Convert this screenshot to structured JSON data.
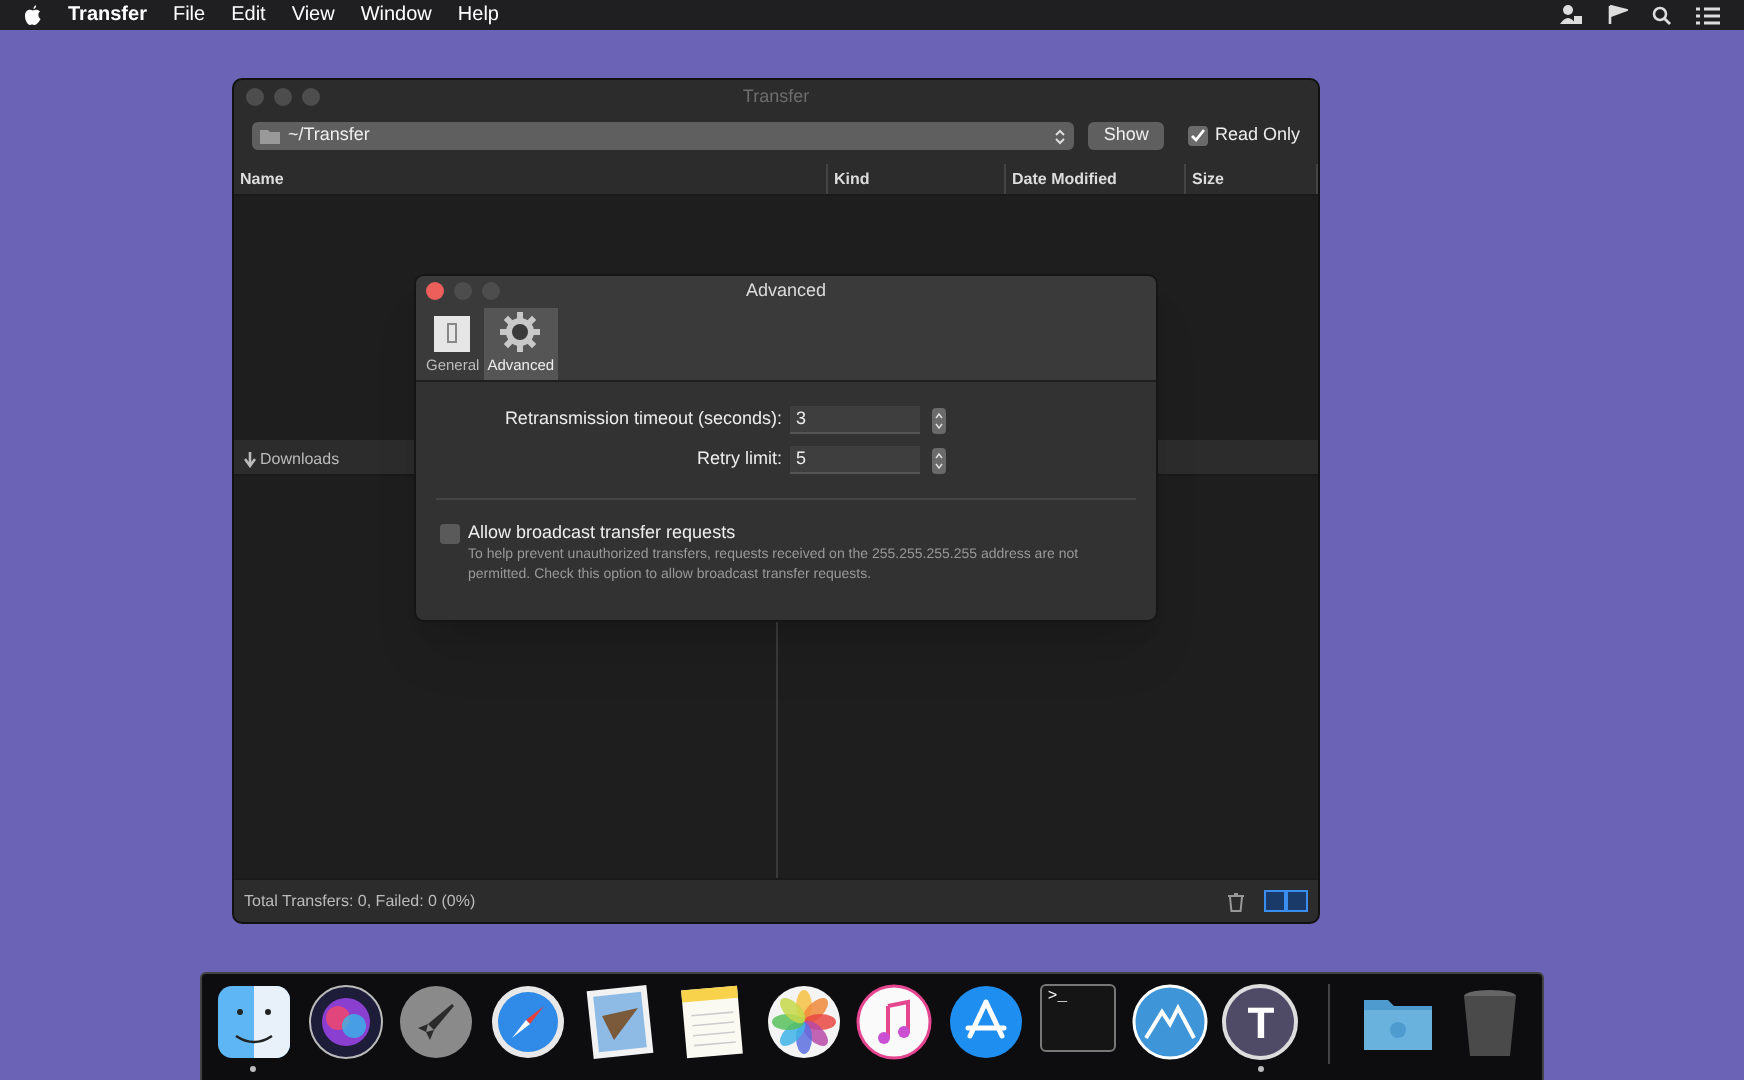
{
  "menu_bar": {
    "app": "Transfer",
    "items": [
      "File",
      "Edit",
      "View",
      "Window",
      "Help"
    ]
  },
  "transfer_window": {
    "title": "Transfer",
    "path": "~/Transfer",
    "show_button": "Show",
    "read_only": {
      "label": "Read Only",
      "checked": true
    },
    "columns": [
      "Name",
      "Kind",
      "Date Modified",
      "Size"
    ],
    "downloads_label": "Downloads",
    "status": "Total Transfers: 0, Failed: 0 (0%)"
  },
  "advanced_dialog": {
    "title": "Advanced",
    "tabs": [
      {
        "label": "General",
        "selected": false,
        "kind": "switch"
      },
      {
        "label": "Advanced",
        "selected": true,
        "kind": "gear"
      }
    ],
    "fields": [
      {
        "label": "Retransmission timeout (seconds):",
        "value": "3"
      },
      {
        "label": "Retry limit:",
        "value": "5"
      }
    ],
    "broadcast": {
      "label": "Allow broadcast transfer requests",
      "checked": false,
      "description": "To help prevent unauthorized transfers, requests received on the 255.255.255.255 address are not permitted. Check this option to allow broadcast transfer requests."
    }
  },
  "dock": {
    "items": [
      {
        "kind": "face",
        "running": true
      },
      {
        "kind": "orb",
        "running": false
      },
      {
        "kind": "rocket",
        "running": false
      },
      {
        "kind": "compass",
        "running": false
      },
      {
        "kind": "stamp",
        "running": false
      },
      {
        "kind": "notes",
        "running": false
      },
      {
        "kind": "flower",
        "running": false
      },
      {
        "kind": "music",
        "running": false
      },
      {
        "kind": "appstore",
        "running": false
      },
      {
        "kind": "terminal",
        "label": ">_",
        "running": false
      },
      {
        "kind": "mountain",
        "running": false
      },
      {
        "kind": "letter",
        "label": "T",
        "running": true
      },
      {
        "kind": "separator"
      },
      {
        "kind": "folder",
        "running": false
      },
      {
        "kind": "trash",
        "running": false
      }
    ]
  }
}
